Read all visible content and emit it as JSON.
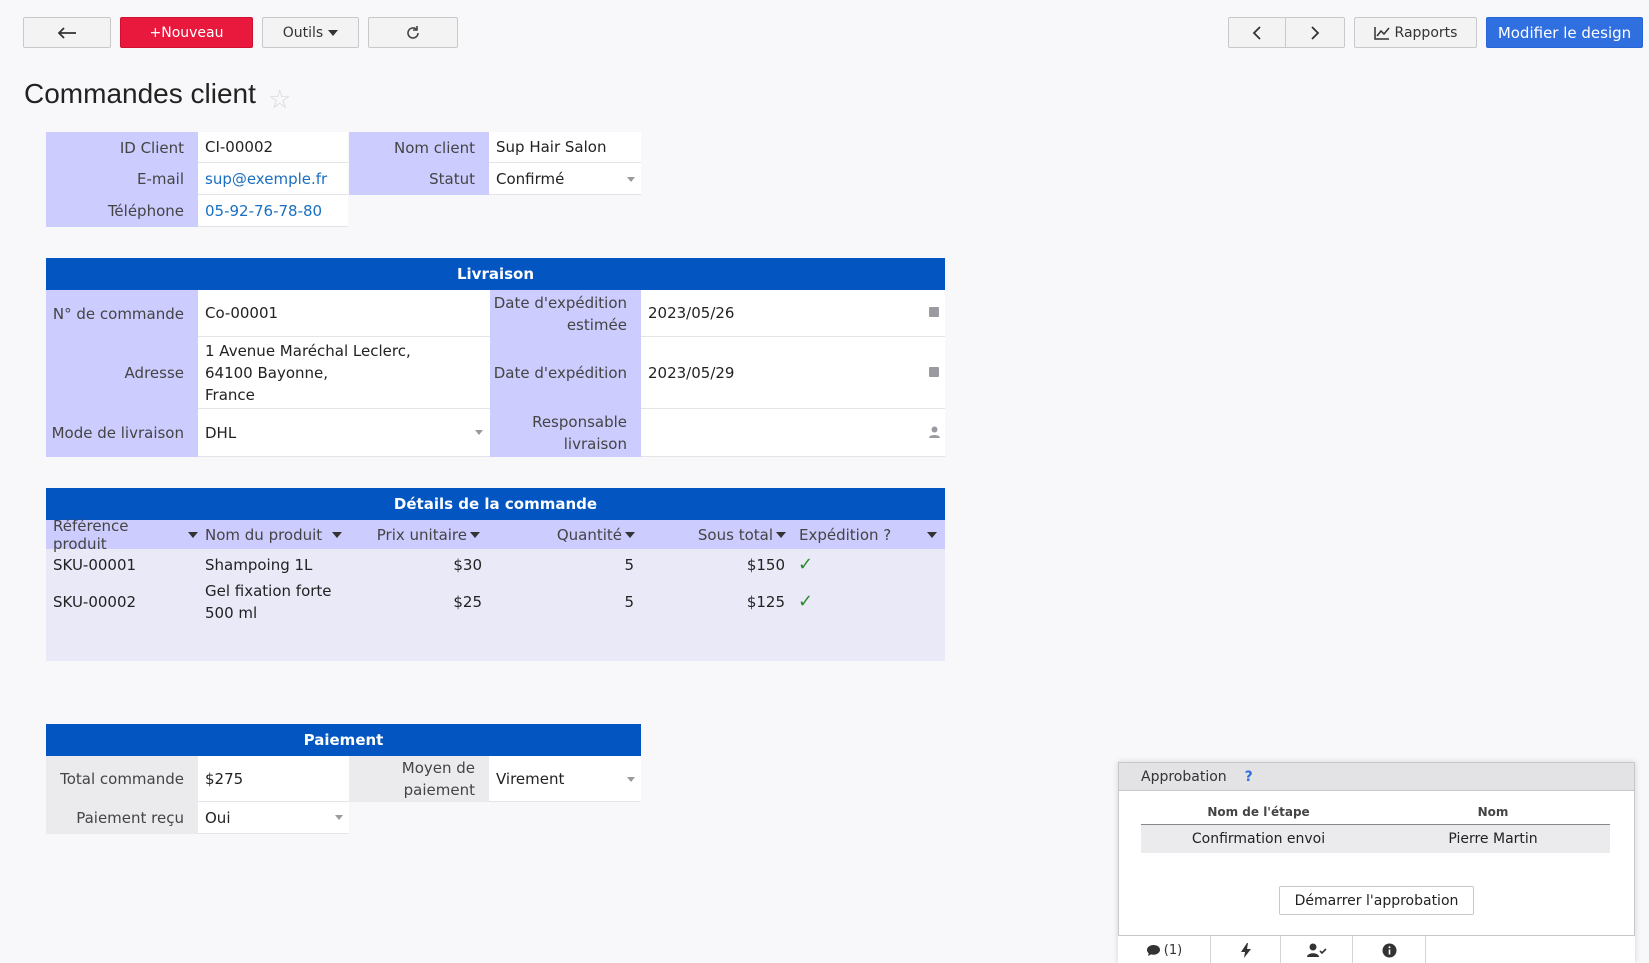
{
  "toolbar": {
    "new_label": "+Nouveau",
    "tools_label": "Outils",
    "reports_label": "Rapports",
    "design_label": "Modifier le design"
  },
  "page": {
    "title": "Commandes client"
  },
  "customer": {
    "id_label": "ID Client",
    "id_value": "CI-00002",
    "email_label": "E-mail",
    "email_value": "sup@exemple.fr",
    "phone_label": "Téléphone",
    "phone_value": "05-92-76-78-80",
    "name_label": "Nom client",
    "name_value": "Sup Hair Salon",
    "status_label": "Statut",
    "status_value": "Confirmé"
  },
  "delivery": {
    "section_title": "Livraison",
    "order_no_label": "N° de commande",
    "order_no_value": "Co-00001",
    "address_label": "Adresse",
    "address_line1": "1 Avenue Maréchal Leclerc,",
    "address_line2": "64100 Bayonne,",
    "address_line3": "France",
    "mode_label": "Mode de livraison",
    "mode_value": "DHL",
    "est_date_label_1": "Date d'expédition",
    "est_date_label_2": "estimée",
    "est_date_value": "2023/05/26",
    "ship_date_label": "Date d'expédition",
    "ship_date_value": "2023/05/29",
    "owner_label_1": "Responsable",
    "owner_label_2": "livraison",
    "owner_value": ""
  },
  "details": {
    "section_title": "Détails de la commande",
    "columns": [
      "Référence produit",
      "Nom du produit",
      "Prix unitaire",
      "Quantité",
      "Sous total",
      "Expédition ?"
    ],
    "rows": [
      {
        "sku": "SKU-00001",
        "name_1": "Shampoing 1L",
        "name_2": "",
        "price": "$30",
        "qty": "5",
        "subtotal": "$150",
        "shipped": true
      },
      {
        "sku": "SKU-00002",
        "name_1": "Gel fixation forte",
        "name_2": "500 ml",
        "price": "$25",
        "qty": "5",
        "subtotal": "$125",
        "shipped": true
      }
    ]
  },
  "payment": {
    "section_title": "Paiement",
    "total_label": "Total commande",
    "total_value": "$275",
    "received_label": "Paiement reçu",
    "received_value": "Oui",
    "method_label_1": "Moyen de",
    "method_label_2": "paiement",
    "method_value": "Virement"
  },
  "approval": {
    "title": "Approbation",
    "help": "?",
    "col_step": "Nom de l'étape",
    "col_name": "Nom",
    "step": "Confirmation envoi",
    "name": "Pierre Martin",
    "start_label": "Démarrer l'approbation"
  },
  "bottom_bar": {
    "comments_count": "(1)"
  },
  "colors": {
    "accent_red": "#e8193c",
    "accent_blue": "#2f6fe0",
    "section_blue": "#0355c1",
    "label_bg": "#ccccff",
    "link": "#1a6fc0"
  }
}
